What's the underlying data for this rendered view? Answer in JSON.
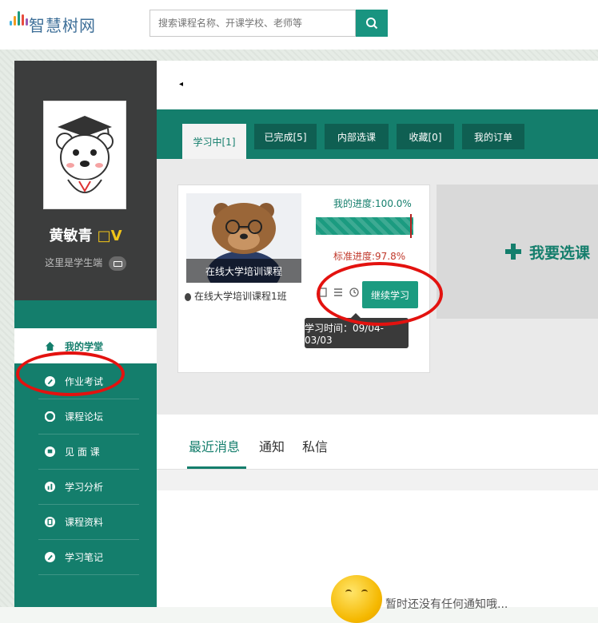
{
  "app": {
    "logo_text": "智慧树网"
  },
  "search": {
    "placeholder": "搜索课程名称、开课学校、老师等"
  },
  "user": {
    "name": "黄敏青",
    "vip_mark": "□V",
    "role_text": "这里是学生端"
  },
  "sidebar": {
    "items": [
      {
        "label": "我的学堂",
        "icon": "home-icon",
        "active": true
      },
      {
        "label": "作业考试",
        "icon": "pencil-icon"
      },
      {
        "label": "课程论坛",
        "icon": "forum-icon"
      },
      {
        "label": "见 面 课",
        "icon": "meeting-icon"
      },
      {
        "label": "学习分析",
        "icon": "chart-icon"
      },
      {
        "label": "课程资料",
        "icon": "file-icon"
      },
      {
        "label": "学习笔记",
        "icon": "note-icon"
      }
    ]
  },
  "notice_glyph": "◂",
  "tabs": [
    {
      "label": "学习中[1]",
      "active": true
    },
    {
      "label": "已完成[5]"
    },
    {
      "label": "内部选课"
    },
    {
      "label": "收藏[0]"
    },
    {
      "label": "我的订单"
    }
  ],
  "course": {
    "image_caption": "在线大学培训课程",
    "class_name": "在线大学培训课程1班",
    "my_progress_label": "我的进度:100.0%",
    "my_progress": 1.0,
    "standard_progress_label": "标准进度:97.8%",
    "standard_progress": 0.978,
    "continue_label": "继续学习",
    "study_time": "学习时间：09/04-03/03"
  },
  "add_course": {
    "label": "我要选课"
  },
  "messages": {
    "tabs": [
      {
        "label": "最近消息",
        "active": true
      },
      {
        "label": "通知"
      },
      {
        "label": "私信"
      }
    ],
    "empty_text": "暂时还没有任何通知哦..."
  },
  "colors": {
    "primary": "#147e6c",
    "sidebar_dark": "#3c3d3d",
    "annotation": "#e3120f"
  }
}
